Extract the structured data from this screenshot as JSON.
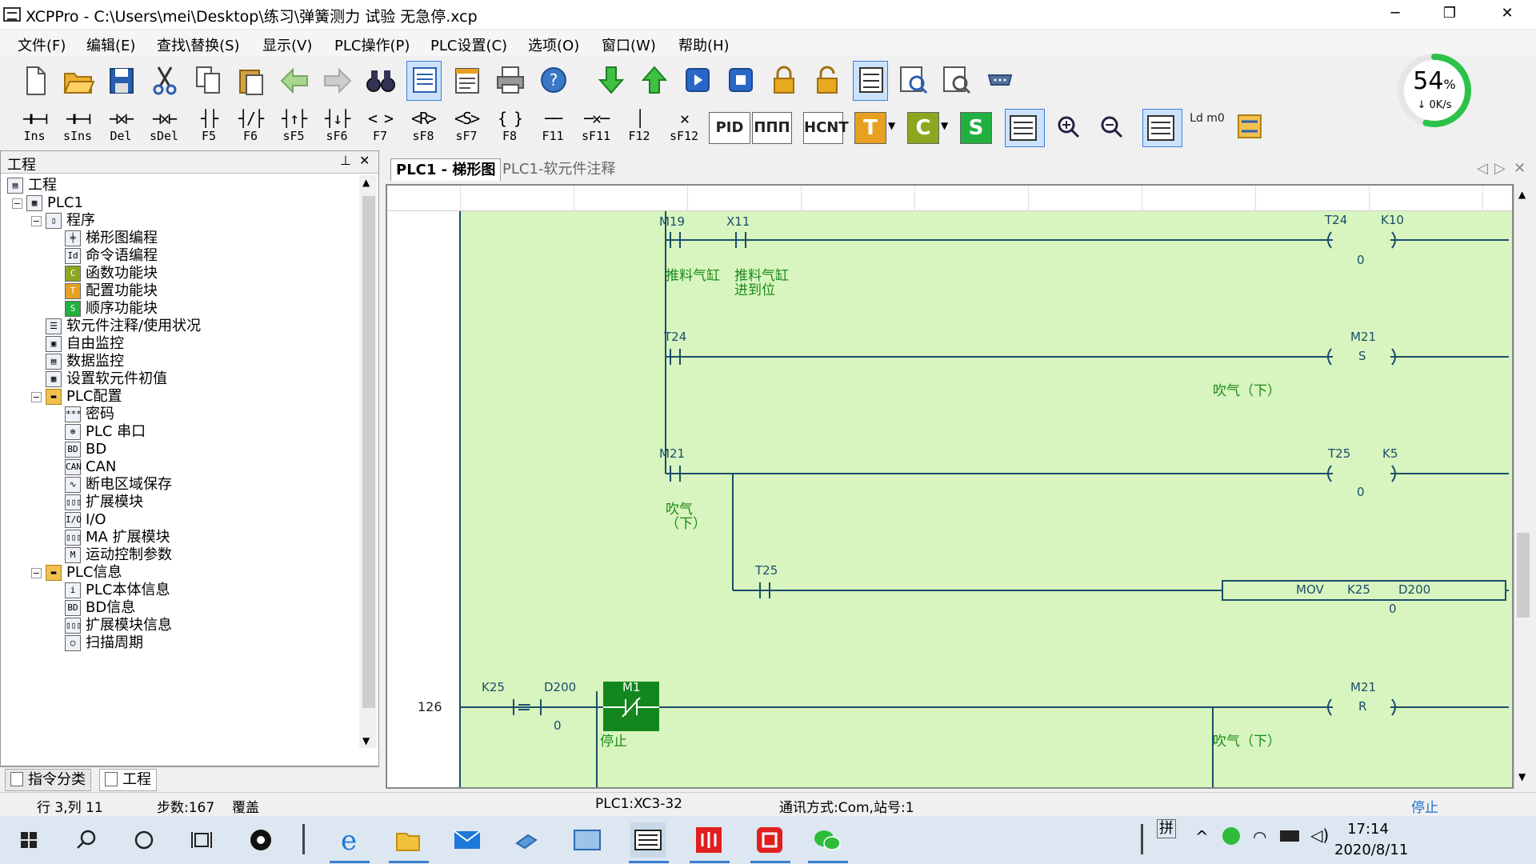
{
  "window": {
    "title": "XCPPro - C:\\Users\\mei\\Desktop\\练习\\弹簧测力 试验 无急停.xcp",
    "minimize": "─",
    "maximize": "❐",
    "close": "✕"
  },
  "menu": [
    "文件(F)",
    "编辑(E)",
    "查找\\替换(S)",
    "显示(V)",
    "PLC操作(P)",
    "PLC设置(C)",
    "选项(O)",
    "窗口(W)",
    "帮助(H)"
  ],
  "toolbar1": [
    "new-file-icon",
    "open-folder-icon",
    "save-icon",
    "cut-icon",
    "copy-icon",
    "paste-icon",
    "back-arrow-icon",
    "forward-arrow-icon",
    "find-binoculars-icon",
    "ladder-view-icon",
    "instruction-view-icon",
    "print-icon",
    "help-icon",
    "download-icon",
    "upload-icon",
    "run-icon",
    "stop-icon",
    "lock-icon",
    "unlock-icon",
    "monitor-icon",
    "free-monitor-icon",
    "data-monitor-icon",
    "serial-port-icon"
  ],
  "toolbar2": [
    {
      "glyph": "⊣⊢⊣",
      "key": "Ins"
    },
    {
      "glyph": "⊣⊢⊣",
      "key": "sIns"
    },
    {
      "glyph": "⊣✕⊢",
      "key": "Del"
    },
    {
      "glyph": "⊣✕⊢",
      "key": "sDel"
    },
    {
      "glyph": "┤├",
      "key": "F5"
    },
    {
      "glyph": "┤/├",
      "key": "F6"
    },
    {
      "glyph": "┤↑├",
      "key": "sF5"
    },
    {
      "glyph": "┤↓├",
      "key": "sF6"
    },
    {
      "glyph": "< >",
      "key": "F7"
    },
    {
      "glyph": "<R>",
      "key": "sF8"
    },
    {
      "glyph": "<S>",
      "key": "sF7"
    },
    {
      "glyph": "{ }",
      "key": "F8"
    },
    {
      "glyph": "──",
      "key": "F11"
    },
    {
      "glyph": "─✕─",
      "key": "sF11"
    },
    {
      "glyph": "│",
      "key": "F12"
    },
    {
      "glyph": "✕",
      "key": "sF12"
    }
  ],
  "toolbar2_extra": {
    "pid": "PID",
    "pulse": "ΠΠΠ",
    "hcnt": "HCNT",
    "t": "T",
    "c": "C",
    "s": "S",
    "ldm0": "Ld m0"
  },
  "speed_gauge": {
    "percent": 54,
    "percent_label": "54",
    "unit": "%",
    "speed": "0K/s",
    "color": "#2cc24a"
  },
  "project_panel": {
    "title": "工程",
    "pin": "⊥",
    "close": "✕",
    "tree": [
      {
        "label": "工程",
        "icon": "project-icon",
        "glyph": "▤"
      },
      {
        "label": "PLC1",
        "icon": "plc-icon",
        "glyph": "▦"
      },
      {
        "label": "程序",
        "icon": "program-icon",
        "glyph": "▯"
      },
      {
        "label": "梯形图编程",
        "icon": "ladder-icon",
        "glyph": "╪"
      },
      {
        "label": "命令语编程",
        "icon": "instruction-icon",
        "glyph": "Id"
      },
      {
        "label": "函数功能块",
        "icon": "function-block-icon",
        "glyph": "C"
      },
      {
        "label": "配置功能块",
        "icon": "config-block-icon",
        "glyph": "T"
      },
      {
        "label": "顺序功能块",
        "icon": "sequence-block-icon",
        "glyph": "S"
      },
      {
        "label": "软元件注释/使用状况",
        "icon": "comment-icon",
        "glyph": "☰"
      },
      {
        "label": "自由监控",
        "icon": "free-monitor-icon",
        "glyph": "▣"
      },
      {
        "label": "数据监控",
        "icon": "data-monitor-icon",
        "glyph": "▤"
      },
      {
        "label": "设置软元件初值",
        "icon": "init-value-icon",
        "glyph": "▦"
      },
      {
        "label": "PLC配置",
        "icon": "folder-icon",
        "glyph": "▬"
      },
      {
        "label": "密码",
        "icon": "password-icon",
        "glyph": "***"
      },
      {
        "label": "PLC 串口",
        "icon": "serial-icon",
        "glyph": "⊕"
      },
      {
        "label": "BD",
        "icon": "bd-icon",
        "glyph": "BD"
      },
      {
        "label": "CAN",
        "icon": "can-icon",
        "glyph": "CAN"
      },
      {
        "label": "断电区域保存",
        "icon": "power-save-icon",
        "glyph": "∿"
      },
      {
        "label": "扩展模块",
        "icon": "expansion-icon",
        "glyph": "▯▯▯"
      },
      {
        "label": "I/O",
        "icon": "io-icon",
        "glyph": "I/O"
      },
      {
        "label": "MA 扩展模块",
        "icon": "ma-expansion-icon",
        "glyph": "▯▯▯"
      },
      {
        "label": "运动控制参数",
        "icon": "motion-icon",
        "glyph": "M"
      },
      {
        "label": "PLC信息",
        "icon": "folder-icon",
        "glyph": "▬"
      },
      {
        "label": "PLC本体信息",
        "icon": "info-icon",
        "glyph": "i"
      },
      {
        "label": "BD信息",
        "icon": "bd-info-icon",
        "glyph": "BD"
      },
      {
        "label": "扩展模块信息",
        "icon": "expansion-info-icon",
        "glyph": "▯▯▯"
      },
      {
        "label": "扫描周期",
        "icon": "scan-cycle-icon",
        "glyph": "○"
      }
    ],
    "tabs": [
      "指令分类",
      "工程"
    ]
  },
  "editor_tabs": [
    "PLC1 - 梯形图",
    "PLC1-软元件注释"
  ],
  "editor_nav": {
    "prev": "◁",
    "next": "▷",
    "close": "✕"
  },
  "ladder": {
    "rung_number": "126",
    "contacts": [
      {
        "device": "M19",
        "comment": "推料气缸"
      },
      {
        "device": "X11",
        "comment": "推料气缸\n进到位"
      },
      {
        "device": "T24",
        "comment": ""
      },
      {
        "device": "M21",
        "comment": "吹气\n（下）"
      },
      {
        "device": "T25",
        "comment": ""
      },
      {
        "device": "K25",
        "comment": ""
      },
      {
        "device": "D200",
        "comment": ""
      },
      {
        "device": "M1",
        "comment": "停止"
      }
    ],
    "outputs": [
      {
        "device": "T24",
        "param": "K10",
        "value": "0"
      },
      {
        "device": "M21",
        "op": "S",
        "comment": "吹气（下）"
      },
      {
        "device": "T25",
        "param": "K5",
        "value": "0"
      },
      {
        "device": "M21",
        "op": "R",
        "comment": "吹气（下）"
      }
    ],
    "mov": {
      "op": "MOV",
      "src": "K25",
      "dst": "D200",
      "value": "0"
    },
    "compare": {
      "op": "=",
      "value": "0"
    }
  },
  "statusbar": {
    "position": "行 3,列 11",
    "steps": "步数:167",
    "mode": "覆盖",
    "plc": "PLC1:XC3-32",
    "comm": "通讯方式:Com,站号:1",
    "state": "停止"
  },
  "taskbar": {
    "time": "17:14",
    "date": "2020/8/11",
    "ime": "拼",
    "icons": [
      "start-icon",
      "search-icon",
      "cortana-icon",
      "task-view-icon",
      "pinwheel-icon",
      "edge-icon",
      "explorer-icon",
      "mail-icon",
      "file-icon",
      "network-app-icon",
      "xcppro-icon",
      "app-red-icon",
      "app-red2-icon",
      "wechat-icon"
    ]
  }
}
